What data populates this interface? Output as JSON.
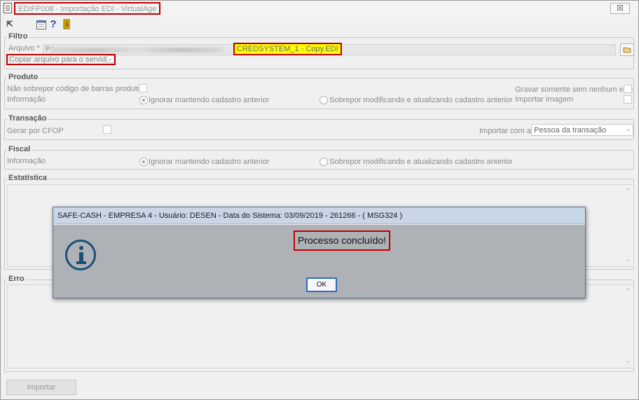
{
  "window": {
    "title": "EDIFP008 - Importação EDI - VirtualAge",
    "close_label": "☒"
  },
  "toolbar": {
    "icons": [
      "exit-icon",
      "calendar-icon",
      "help-icon",
      "door-icon"
    ],
    "help_glyph": "?"
  },
  "filtro": {
    "legend": "Filtro",
    "arquivo_label": "Arquivo *",
    "arquivo_path": "P:\\",
    "arquivo_filename": "CREDSYSTEM_1 - Copy.EDI",
    "copiar_label": "Copiar arquivo para o servidor",
    "copiar_checked": true
  },
  "produto": {
    "legend": "Produto",
    "nao_sobrepor_label": "Não sobrepor código de barras produto",
    "informacao_label": "Informação",
    "radio_ignorar": "Ignorar mantendo cadastro anterior",
    "radio_sobrepor": "Sobrepor modificando e atualizando cadastro anterior",
    "gravar_label": "Gravar somente sem nenhum erro",
    "importar_imagem_label": "Importar imagem"
  },
  "transacao": {
    "legend": "Transação",
    "gerar_cfop_label": "Gerar por CFOP",
    "importar_com_label": "Importar com a",
    "importar_com_value": "Pessoa da transação"
  },
  "fiscal": {
    "legend": "Fiscal",
    "informacao_label": "Informação",
    "radio_ignorar": "Ignorar mantendo cadastro anterior",
    "radio_sobrepor": "Sobrepor modificando e atualizando cadastro anterior"
  },
  "estatistica": {
    "legend": "Estatística"
  },
  "erro": {
    "legend": "Erro"
  },
  "footer": {
    "importar_label": "Importar"
  },
  "dialog": {
    "title": "SAFE-CASH - EMPRESA 4 - Usuário: DESEN - Data do Sistema: 03/09/2019 - 261266 - ( MSG324 )",
    "message": "Processo concluído!",
    "ok_label": "OK",
    "icon": "info-icon"
  },
  "colors": {
    "highlight_border": "#c00000",
    "filename_highlight": "#ffff00",
    "dialog_title_bg": "#c9d6e6",
    "dialog_body_bg": "#aeb2b7",
    "info_icon": "#1a4f78"
  }
}
